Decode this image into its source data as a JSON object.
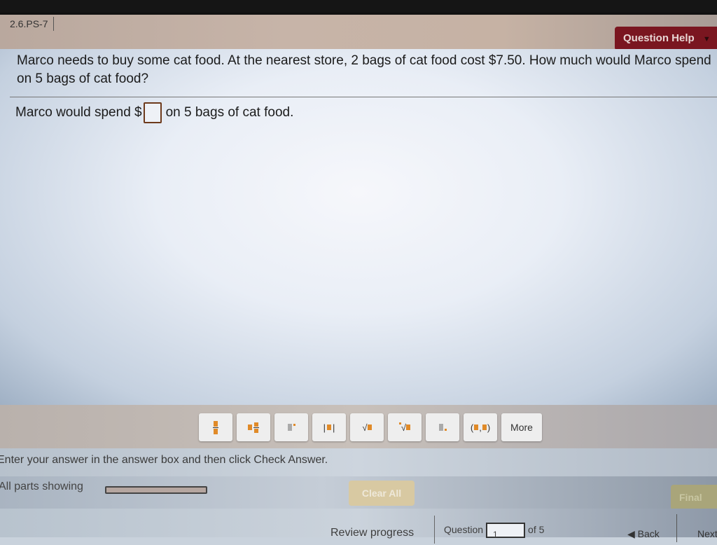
{
  "header": {
    "question_id": "2.6.PS-7",
    "help_button": "Question Help",
    "help_caret": "▼"
  },
  "question": {
    "text": "Marco needs to buy some cat food. At the nearest store, 2 bags of cat food cost $7.50. How much would Marco spend on 5 bags of cat food?",
    "answer_prefix": "Marco would spend $",
    "answer_value": "",
    "answer_suffix": "on 5 bags of cat food."
  },
  "toolbar": {
    "tools": [
      {
        "name": "fraction-tool",
        "label": "fraction"
      },
      {
        "name": "mixed-number-tool",
        "label": "mixed number"
      },
      {
        "name": "exponent-tool",
        "label": "exponent"
      },
      {
        "name": "absolute-value-tool",
        "label": "absolute value"
      },
      {
        "name": "square-root-tool",
        "label": "√"
      },
      {
        "name": "nth-root-tool",
        "label": "∜"
      },
      {
        "name": "subscript-tool",
        "label": "subscript"
      },
      {
        "name": "ordered-pair-tool",
        "label": "(,)"
      }
    ],
    "more_label": "More"
  },
  "instructions": "Enter your answer in the answer box and then click Check Answer.",
  "status": {
    "parts_label": "All parts showing",
    "clear_all": "Clear All",
    "final_check": "Final Check"
  },
  "nav": {
    "review_progress": "Review progress",
    "question_label": "Question",
    "question_number": "1",
    "of_label": "of 5",
    "back": "◀ Back",
    "next": "Next"
  }
}
